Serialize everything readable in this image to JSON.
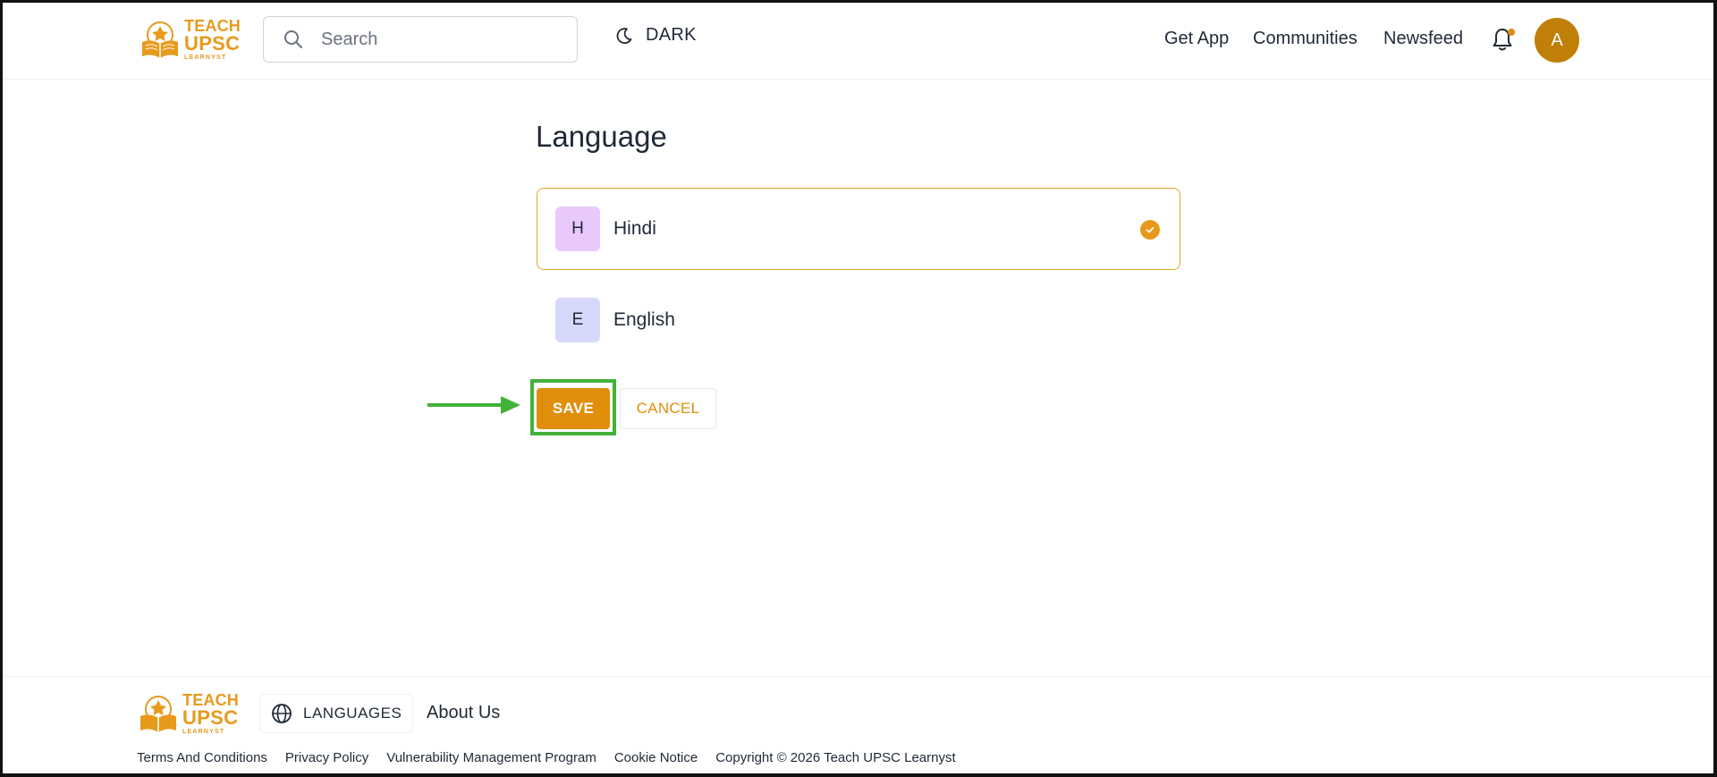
{
  "header": {
    "logo": {
      "line1": "TEACH",
      "line2": "UPSC",
      "line3": "LEARNYST"
    },
    "search": {
      "placeholder": "Search",
      "value": ""
    },
    "theme_toggle_label": "DARK",
    "nav": [
      {
        "label": "Get App"
      },
      {
        "label": "Communities"
      },
      {
        "label": "Newsfeed"
      }
    ],
    "notification_badge": true,
    "avatar_initial": "A"
  },
  "main": {
    "title": "Language",
    "options": [
      {
        "initial": "H",
        "label": "Hindi",
        "selected": true,
        "badge_color": "#e9c8fb"
      },
      {
        "initial": "E",
        "label": "English",
        "selected": false,
        "badge_color": "#d6d9fb"
      }
    ],
    "save_label": "SAVE",
    "cancel_label": "CANCEL"
  },
  "footer": {
    "languages_label": "LANGUAGES",
    "about_label": "About Us",
    "links": [
      {
        "label": "Terms And Conditions"
      },
      {
        "label": "Privacy Policy"
      },
      {
        "label": "Vulnerability Management Program"
      },
      {
        "label": "Cookie Notice"
      }
    ],
    "copyright": "Copyright © 2026 Teach UPSC Learnyst"
  },
  "colors": {
    "accent": "#e08e0b",
    "highlight": "#43b13a",
    "avatar": "#c07f07"
  }
}
